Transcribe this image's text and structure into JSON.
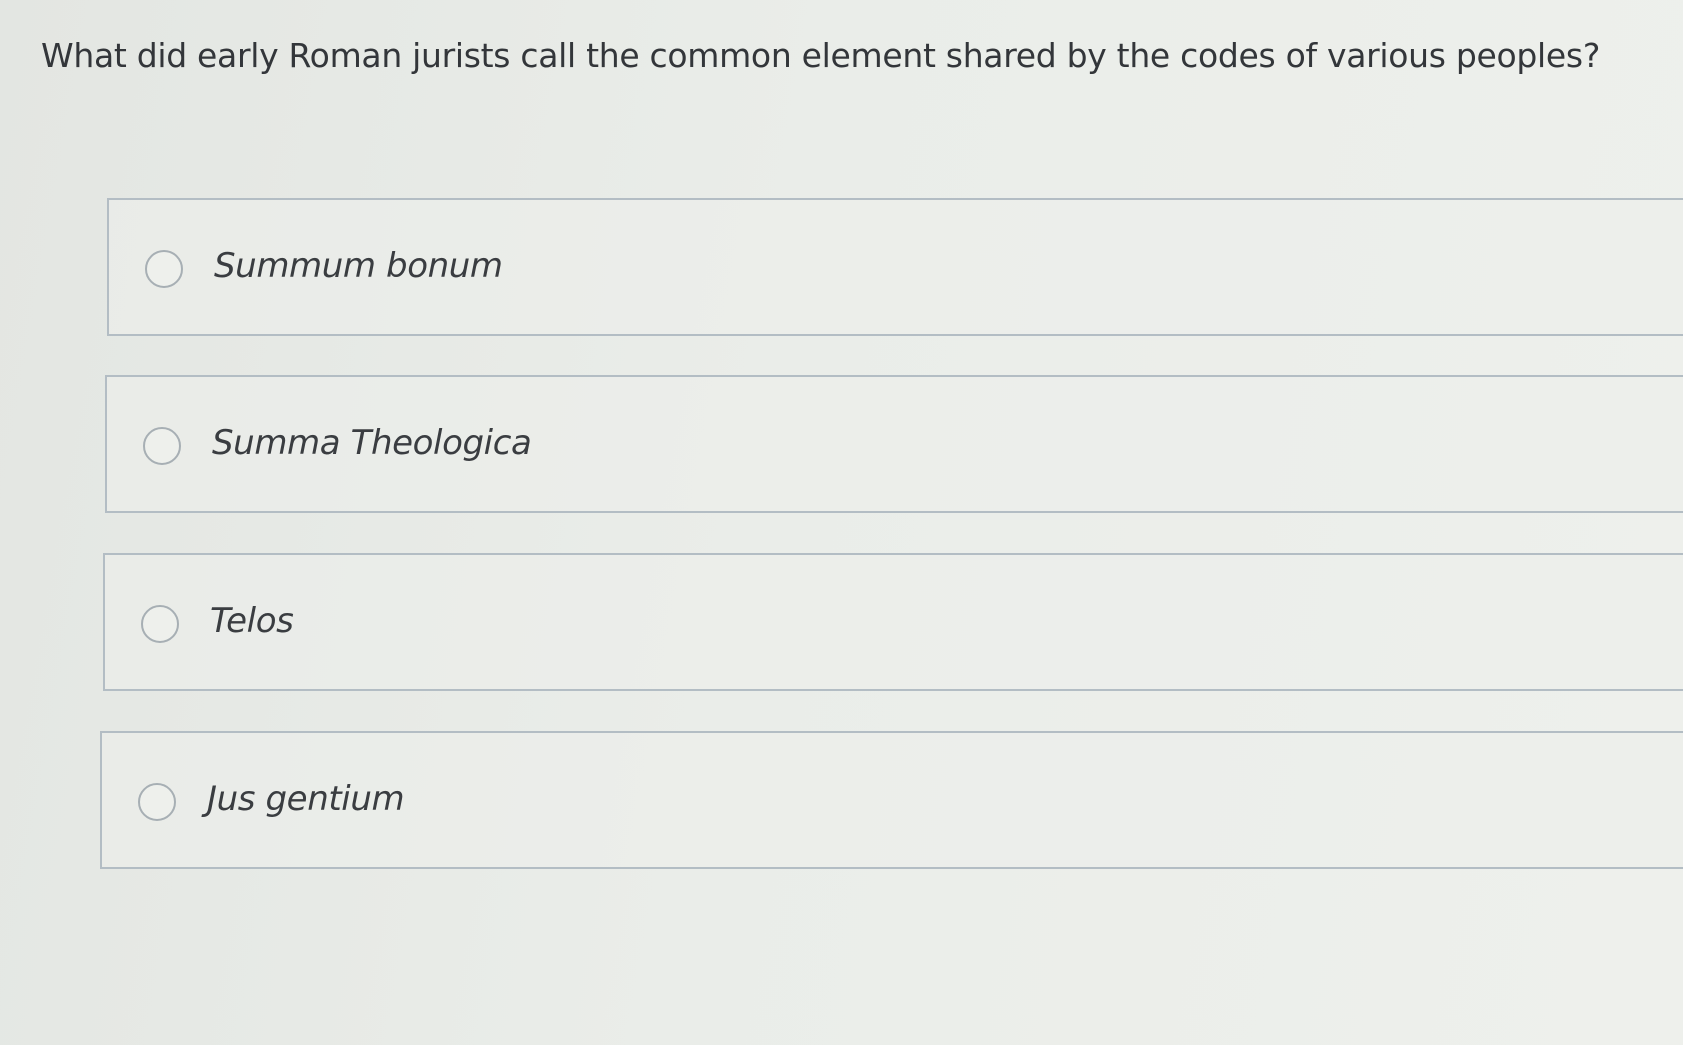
{
  "question": {
    "text": "What did early Roman jurists call the common element shared by the codes of various peoples?"
  },
  "options": [
    {
      "label": "Summum bonum",
      "selected": false
    },
    {
      "label": "Summa Theologica",
      "selected": false
    },
    {
      "label": "Telos",
      "selected": false
    },
    {
      "label": "Jus gentium",
      "selected": false
    }
  ],
  "colors": {
    "background": "#e8ebe7",
    "border": "#b3bdc4",
    "text": "#33363a"
  }
}
